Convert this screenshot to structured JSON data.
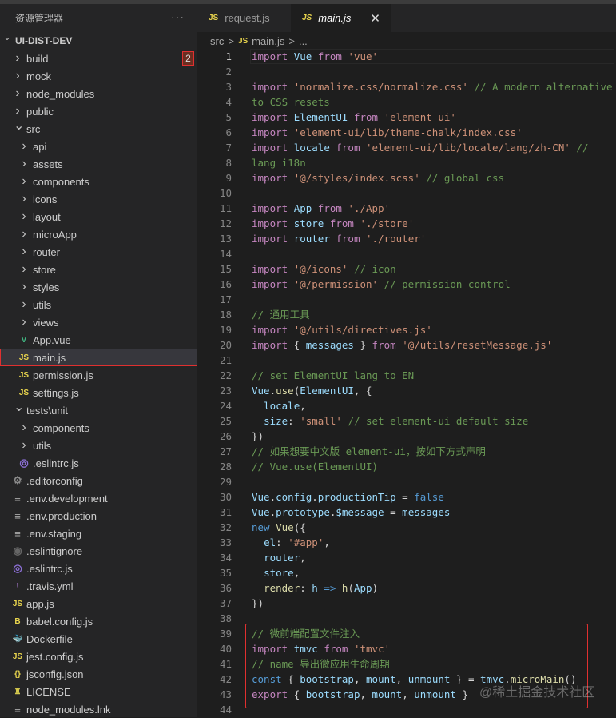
{
  "sidebar": {
    "title": "资源管理器",
    "more": "···",
    "root": "UI-DIST-DEV",
    "items": [
      {
        "label": "build",
        "kind": "folder",
        "depth": 1,
        "badge": "2"
      },
      {
        "label": "mock",
        "kind": "folder",
        "depth": 1
      },
      {
        "label": "node_modules",
        "kind": "folder",
        "depth": 1
      },
      {
        "label": "public",
        "kind": "folder",
        "depth": 1
      },
      {
        "label": "src",
        "kind": "folder",
        "depth": 1,
        "open": true
      },
      {
        "label": "api",
        "kind": "folder",
        "depth": 2
      },
      {
        "label": "assets",
        "kind": "folder",
        "depth": 2
      },
      {
        "label": "components",
        "kind": "folder",
        "depth": 2
      },
      {
        "label": "icons",
        "kind": "folder",
        "depth": 2
      },
      {
        "label": "layout",
        "kind": "folder",
        "depth": 2
      },
      {
        "label": "microApp",
        "kind": "folder",
        "depth": 2
      },
      {
        "label": "router",
        "kind": "folder",
        "depth": 2
      },
      {
        "label": "store",
        "kind": "folder",
        "depth": 2
      },
      {
        "label": "styles",
        "kind": "folder",
        "depth": 2
      },
      {
        "label": "utils",
        "kind": "folder",
        "depth": 2
      },
      {
        "label": "views",
        "kind": "folder",
        "depth": 2
      },
      {
        "label": "App.vue",
        "kind": "file",
        "depth": 2,
        "icon": "vue"
      },
      {
        "label": "main.js",
        "kind": "file",
        "depth": 2,
        "icon": "js",
        "selected": true
      },
      {
        "label": "permission.js",
        "kind": "file",
        "depth": 2,
        "icon": "js"
      },
      {
        "label": "settings.js",
        "kind": "file",
        "depth": 2,
        "icon": "js"
      },
      {
        "label": "tests\\unit",
        "kind": "folder",
        "depth": 1,
        "open": true
      },
      {
        "label": "components",
        "kind": "folder",
        "depth": 2
      },
      {
        "label": "utils",
        "kind": "folder",
        "depth": 2
      },
      {
        "label": ".eslintrc.js",
        "kind": "file",
        "depth": 2,
        "icon": "eslint"
      },
      {
        "label": ".editorconfig",
        "kind": "file",
        "depth": 1,
        "icon": "gear"
      },
      {
        "label": ".env.development",
        "kind": "file",
        "depth": 1,
        "icon": "lines"
      },
      {
        "label": ".env.production",
        "kind": "file",
        "depth": 1,
        "icon": "lines"
      },
      {
        "label": ".env.staging",
        "kind": "file",
        "depth": 1,
        "icon": "lines"
      },
      {
        "label": ".eslintignore",
        "kind": "file",
        "depth": 1,
        "icon": "ignore"
      },
      {
        "label": ".eslintrc.js",
        "kind": "file",
        "depth": 1,
        "icon": "eslint"
      },
      {
        "label": ".travis.yml",
        "kind": "file",
        "depth": 1,
        "icon": "yml"
      },
      {
        "label": "app.js",
        "kind": "file",
        "depth": 1,
        "icon": "js"
      },
      {
        "label": "babel.config.js",
        "kind": "file",
        "depth": 1,
        "icon": "babel"
      },
      {
        "label": "Dockerfile",
        "kind": "file",
        "depth": 1,
        "icon": "docker"
      },
      {
        "label": "jest.config.js",
        "kind": "file",
        "depth": 1,
        "icon": "js"
      },
      {
        "label": "jsconfig.json",
        "kind": "file",
        "depth": 1,
        "icon": "json"
      },
      {
        "label": "LICENSE",
        "kind": "file",
        "depth": 1,
        "icon": "license"
      },
      {
        "label": "node_modules.lnk",
        "kind": "file",
        "depth": 1,
        "icon": "lines"
      }
    ]
  },
  "tabs": [
    {
      "label": "request.js",
      "icon": "JS"
    },
    {
      "label": "main.js",
      "icon": "JS",
      "active": true,
      "close": "✕"
    }
  ],
  "breadcrumb": {
    "folder": "src",
    "sep": ">",
    "icon": "JS",
    "file": "main.js",
    "more": "..."
  },
  "code": [
    [
      [
        "import ",
        "kw"
      ],
      [
        "Vue ",
        "var"
      ],
      [
        "from ",
        "kw"
      ],
      [
        "'vue'",
        "str"
      ]
    ],
    [],
    [
      [
        "import ",
        "kw"
      ],
      [
        "'normalize.css/normalize.css' ",
        "str"
      ],
      [
        "// A modern alternative to CSS resets",
        "cm"
      ]
    ],
    [],
    [
      [
        "import ",
        "kw"
      ],
      [
        "ElementUI ",
        "var"
      ],
      [
        "from ",
        "kw"
      ],
      [
        "'element-ui'",
        "str"
      ]
    ],
    [
      [
        "import ",
        "kw"
      ],
      [
        "'element-ui/lib/theme-chalk/index.css'",
        "str"
      ]
    ],
    [
      [
        "import ",
        "kw"
      ],
      [
        "locale ",
        "var"
      ],
      [
        "from ",
        "kw"
      ],
      [
        "'element-ui/lib/locale/lang/zh-CN' ",
        "str"
      ],
      [
        "// lang i18n",
        "cm"
      ]
    ],
    [],
    [
      [
        "import ",
        "kw"
      ],
      [
        "'@/styles/index.scss' ",
        "str"
      ],
      [
        "// global css",
        "cm"
      ]
    ],
    [],
    [
      [
        "import ",
        "kw"
      ],
      [
        "App ",
        "var"
      ],
      [
        "from ",
        "kw"
      ],
      [
        "'./App'",
        "str"
      ]
    ],
    [
      [
        "import ",
        "kw"
      ],
      [
        "store ",
        "var"
      ],
      [
        "from ",
        "kw"
      ],
      [
        "'./store'",
        "str"
      ]
    ],
    [
      [
        "import ",
        "kw"
      ],
      [
        "router ",
        "var"
      ],
      [
        "from ",
        "kw"
      ],
      [
        "'./router'",
        "str"
      ]
    ],
    [],
    [
      [
        "import ",
        "kw"
      ],
      [
        "'@/icons' ",
        "str"
      ],
      [
        "// icon",
        "cm"
      ]
    ],
    [
      [
        "import ",
        "kw"
      ],
      [
        "'@/permission' ",
        "str"
      ],
      [
        "// permission control",
        "cm"
      ]
    ],
    [],
    [
      [
        "// 通用工具",
        "cm"
      ]
    ],
    [
      [
        "import ",
        "kw"
      ],
      [
        "'@/utils/directives.js'",
        "str"
      ]
    ],
    [
      [
        "import ",
        "kw"
      ],
      [
        "{ ",
        "p"
      ],
      [
        "messages ",
        "var"
      ],
      [
        "} ",
        "p"
      ],
      [
        "from ",
        "kw"
      ],
      [
        "'@/utils/resetMessage.js'",
        "str"
      ]
    ],
    [],
    [
      [
        "// set ElementUI lang to EN",
        "cm"
      ]
    ],
    [
      [
        "Vue",
        "var"
      ],
      [
        ".",
        "p"
      ],
      [
        "use",
        "fn"
      ],
      [
        "(",
        "p"
      ],
      [
        "ElementUI",
        "var"
      ],
      [
        ", {",
        "p"
      ]
    ],
    [
      [
        "  locale",
        "var"
      ],
      [
        ",",
        "p"
      ]
    ],
    [
      [
        "  size",
        "var"
      ],
      [
        ": ",
        "p"
      ],
      [
        "'small' ",
        "str"
      ],
      [
        "// set element-ui default size",
        "cm"
      ]
    ],
    [
      [
        "})",
        "p"
      ]
    ],
    [
      [
        "// 如果想要中文版 element-ui，按如下方式声明",
        "cm"
      ]
    ],
    [
      [
        "// Vue.use(ElementUI)",
        "cm"
      ]
    ],
    [],
    [
      [
        "Vue",
        "var"
      ],
      [
        ".",
        "p"
      ],
      [
        "config",
        "var"
      ],
      [
        ".",
        "p"
      ],
      [
        "productionTip ",
        "var"
      ],
      [
        "= ",
        "p"
      ],
      [
        "false",
        "bl"
      ]
    ],
    [
      [
        "Vue",
        "var"
      ],
      [
        ".",
        "p"
      ],
      [
        "prototype",
        "var"
      ],
      [
        ".",
        "p"
      ],
      [
        "$message ",
        "var"
      ],
      [
        "= ",
        "p"
      ],
      [
        "messages",
        "var"
      ]
    ],
    [
      [
        "new ",
        "bl"
      ],
      [
        "Vue",
        "fn"
      ],
      [
        "({",
        "p"
      ]
    ],
    [
      [
        "  el",
        "var"
      ],
      [
        ": ",
        "p"
      ],
      [
        "'#app'",
        "str"
      ],
      [
        ",",
        "p"
      ]
    ],
    [
      [
        "  router",
        "var"
      ],
      [
        ",",
        "p"
      ]
    ],
    [
      [
        "  store",
        "var"
      ],
      [
        ",",
        "p"
      ]
    ],
    [
      [
        "  render",
        "fn"
      ],
      [
        ": ",
        "p"
      ],
      [
        "h ",
        "var"
      ],
      [
        "=> ",
        "bl"
      ],
      [
        "h",
        "fn"
      ],
      [
        "(",
        "p"
      ],
      [
        "App",
        "var"
      ],
      [
        ")",
        "p"
      ]
    ],
    [
      [
        "})",
        "p"
      ]
    ],
    [],
    [
      [
        "// 微前端配置文件注入",
        "cm"
      ]
    ],
    [
      [
        "import ",
        "kw"
      ],
      [
        "tmvc ",
        "var"
      ],
      [
        "from ",
        "kw"
      ],
      [
        "'tmvc'",
        "str"
      ]
    ],
    [
      [
        "// name 导出微应用生命周期",
        "cm"
      ]
    ],
    [
      [
        "const ",
        "bl"
      ],
      [
        "{ ",
        "p"
      ],
      [
        "bootstrap",
        "var"
      ],
      [
        ", ",
        "p"
      ],
      [
        "mount",
        "var"
      ],
      [
        ", ",
        "p"
      ],
      [
        "unmount ",
        "var"
      ],
      [
        "} = ",
        "p"
      ],
      [
        "tmvc",
        "var"
      ],
      [
        ".",
        "p"
      ],
      [
        "microMain",
        "fn"
      ],
      [
        "()",
        "p"
      ]
    ],
    [
      [
        "export ",
        "kw"
      ],
      [
        "{ ",
        "p"
      ],
      [
        "bootstrap",
        "var"
      ],
      [
        ", ",
        "p"
      ],
      [
        "mount",
        "var"
      ],
      [
        ", ",
        "p"
      ],
      [
        "unmount ",
        "var"
      ],
      [
        "}",
        "p"
      ]
    ],
    []
  ],
  "watermark": "@稀土掘金技术社区",
  "colors": {
    "accent_red": "#e03030",
    "js_yellow": "#e8d44d"
  }
}
